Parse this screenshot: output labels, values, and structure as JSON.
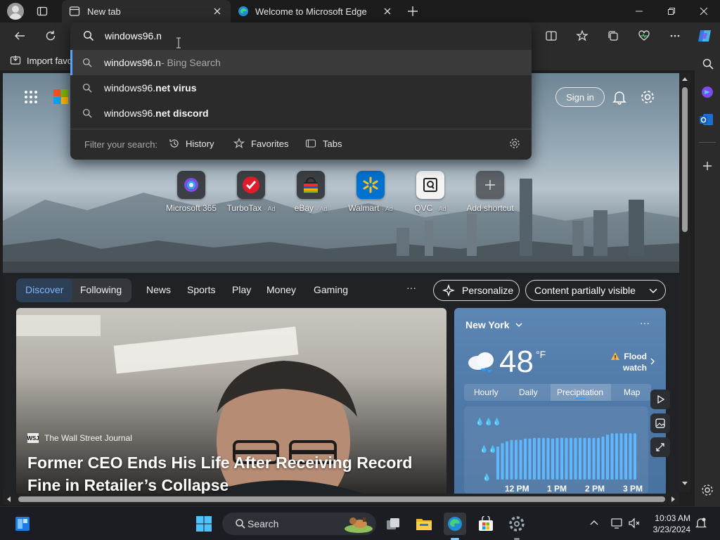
{
  "tabs": [
    {
      "label": "New tab"
    },
    {
      "label": "Welcome to Microsoft Edge"
    }
  ],
  "address_bar": {
    "value": "windows96.n"
  },
  "favorites_bar": {
    "import_label": "Import favo"
  },
  "suggestions": [
    {
      "main": "windows96.n",
      "bold": "",
      "suffix": " - Bing Search"
    },
    {
      "main": "windows96.",
      "bold": "net virus",
      "suffix": ""
    },
    {
      "main": "windows96.",
      "bold": "net discord",
      "suffix": ""
    }
  ],
  "filter": {
    "label": "Filter your search:",
    "history": "History",
    "favorites": "Favorites",
    "tabs": "Tabs"
  },
  "header": {
    "sign_in": "Sign in"
  },
  "shortcuts": [
    {
      "label": "Microsoft 365",
      "ad": ""
    },
    {
      "label": "TurboTax",
      "ad": "· Ad"
    },
    {
      "label": "eBay",
      "ad": "· Ad"
    },
    {
      "label": "Walmart",
      "ad": "· Ad"
    },
    {
      "label": "QVC",
      "ad": "· Ad"
    },
    {
      "label": "Add shortcut",
      "ad": ""
    }
  ],
  "feed_nav": {
    "discover": "Discover",
    "following": "Following",
    "items": [
      "News",
      "Sports",
      "Play",
      "Money",
      "Gaming"
    ],
    "more": "···",
    "personalize": "Personalize",
    "content": "Content partially visible"
  },
  "article": {
    "source": "The Wall Street Journal",
    "source_badge": "WSJ",
    "title_line1": "Former CEO Ends His Life After Receiving Record",
    "title_line2": "Fine in Retailer’s Collapse"
  },
  "weather": {
    "city": "New York",
    "temp": "48",
    "unit": "°F",
    "alert_line1": "Flood",
    "alert_line2": "watch",
    "tabs": [
      "Hourly",
      "Daily",
      "Precipitation",
      "Map"
    ],
    "active_tab": "Precipitation",
    "time_labels": [
      "12 PM",
      "1 PM",
      "2 PM",
      "3 PM"
    ],
    "precip_levels": [
      0.5,
      0.55,
      0.58,
      0.6,
      0.6,
      0.6,
      0.62,
      0.62,
      0.63,
      0.63,
      0.63,
      0.63,
      0.62,
      0.63,
      0.63,
      0.63,
      0.63,
      0.63,
      0.63,
      0.63,
      0.63,
      0.63,
      0.63,
      0.65,
      0.68,
      0.7,
      0.7,
      0.7,
      0.7,
      0.7,
      0.7
    ]
  },
  "taskbar": {
    "search": "Search",
    "time": "10:03 AM",
    "date": "3/23/2024"
  }
}
